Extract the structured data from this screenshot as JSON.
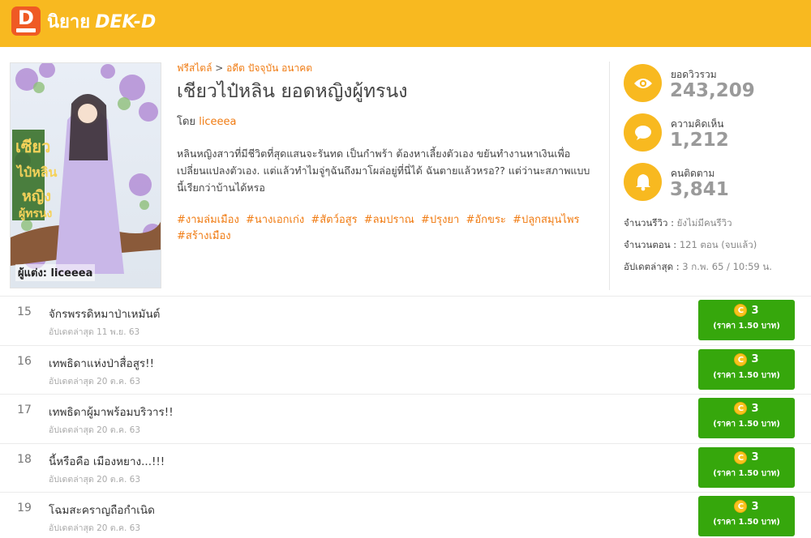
{
  "header": {
    "logo_letter": "D",
    "site_name": "นิยาย",
    "brand": "DEK-D",
    "colors": {
      "bar": "#f8b920",
      "badge": "#ef5a24"
    }
  },
  "cover": {
    "author_caption": "ผู้แต่ง: liceeea"
  },
  "novel": {
    "breadcrumb": {
      "category": "ฟรีสไตล์",
      "separator": ">",
      "subcategory": "อดีต ปัจจุบัน อนาคต"
    },
    "title": "เชียวไป๋หลิน ยอดหญิงผู้ทรนง",
    "by_label": "โดย",
    "author": "liceeea",
    "synopsis": "หลินหญิงสาวที่มีชีวิตที่สุดแสนจะรันทด เป็นกำพร้า ต้องหาเลี้ยงตัวเอง ขยันทำงานหาเงินเพื่อเปลี่ยนแปลงตัวเอง. แต่แล้วทำไมจู่ๆฉันถึงมาโผล่อยู่ที่นี่ได้ ฉันตายแล้วหรอ?? แต่ว่านะสภาพแบบนี้เรียกว่าบ้านได้หรอ",
    "tags": [
      "#งามล่มเมือง",
      "#นางเอกเก่ง",
      "#สัตว์อสูร",
      "#ลมปราณ",
      "#ปรุงยา",
      "#อักขระ",
      "#ปลูกสมุนไพร",
      "#สร้างเมือง"
    ]
  },
  "stats": {
    "views": {
      "label": "ยอดวิวรวม",
      "value": "243,209",
      "icon": "eye-icon"
    },
    "comments": {
      "label": "ความคิดเห็น",
      "value": "1,212",
      "icon": "speech-bubble-icon"
    },
    "followers": {
      "label": "คนติดตาม",
      "value": "3,841",
      "icon": "bell-icon"
    }
  },
  "meta": {
    "reviews_label": "จำนวนรีวิว :",
    "reviews_value": "ยังไม่มีคนรีวิว",
    "episodes_label": "จำนวนตอน :",
    "episodes_value": "121 ตอน (จบแล้ว)",
    "updated_label": "อัปเดตล่าสุด :",
    "updated_value": "3 ก.พ. 65 / 10:59 น."
  },
  "episodes": [
    {
      "num": "15",
      "title": "จักรพรรดิหมาป่าเหมันต์",
      "date": "อัปเดตล่าสุด 11 พ.ย. 63",
      "coins": "3",
      "price": "(ราคา 1.50 บาท)"
    },
    {
      "num": "16",
      "title": "เทพธิดาแห่งป่าสื่อสูร!!",
      "date": "อัปเดตล่าสุด 20 ต.ค. 63",
      "coins": "3",
      "price": "(ราคา 1.50 บาท)"
    },
    {
      "num": "17",
      "title": "เทพธิดาผู้มาพร้อมบริวาร!!",
      "date": "อัปเดตล่าสุด 20 ต.ค. 63",
      "coins": "3",
      "price": "(ราคา 1.50 บาท)"
    },
    {
      "num": "18",
      "title": "นี้หรือคือ เมืองหยาง...!!!",
      "date": "อัปเดตล่าสุด 20 ต.ค. 63",
      "coins": "3",
      "price": "(ราคา 1.50 บาท)"
    },
    {
      "num": "19",
      "title": "โฉมสะคราญถือกำเนิด",
      "date": "อัปเดตล่าสุด 20 ต.ค. 63",
      "coins": "3",
      "price": "(ราคา 1.50 บาท)"
    }
  ],
  "coin_symbol": "C"
}
